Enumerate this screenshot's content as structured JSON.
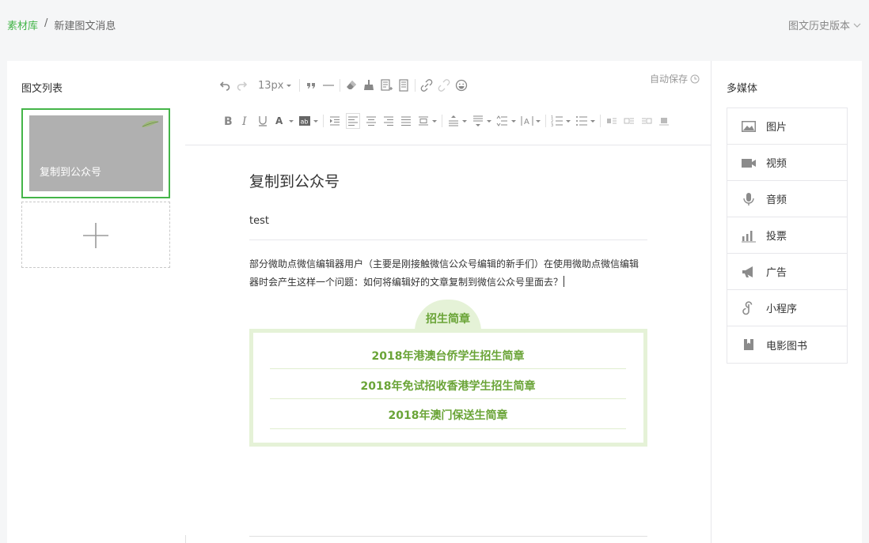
{
  "breadcrumb": {
    "home": "素材库",
    "separator": "/",
    "current": "新建图文消息"
  },
  "history_label": "图文历史版本",
  "left": {
    "title": "图文列表",
    "card_title": "复制到公众号",
    "cover_color": "#b0b0b0",
    "active_border": "#44b549"
  },
  "editor": {
    "autosave": "自动保存",
    "font_size": "13px",
    "title": "复制到公众号",
    "author": "test",
    "body": "部分微助点微信编辑器用户（主要是刚接触微信公众号编辑的新手们）在使用微助点微信编辑器时会产生这样一个问题：如何将编辑好的文章复制到微信公众号里面去？",
    "notice": {
      "tab": "招生简章",
      "items": [
        "2018年港澳台侨学生招生简章",
        "2018年免试招收香港学生招生简章",
        "2018年澳门保送生简章"
      ],
      "accent": "#6aa437",
      "bg": "#e5f2d7"
    }
  },
  "media": {
    "title": "多媒体",
    "items": [
      {
        "label": "图片",
        "icon": "image-icon"
      },
      {
        "label": "视频",
        "icon": "video-icon"
      },
      {
        "label": "音频",
        "icon": "microphone-icon"
      },
      {
        "label": "投票",
        "icon": "chart-icon"
      },
      {
        "label": "广告",
        "icon": "megaphone-icon"
      },
      {
        "label": "小程序",
        "icon": "mini-program-icon"
      },
      {
        "label": "电影图书",
        "icon": "bookmark-icon"
      }
    ]
  }
}
